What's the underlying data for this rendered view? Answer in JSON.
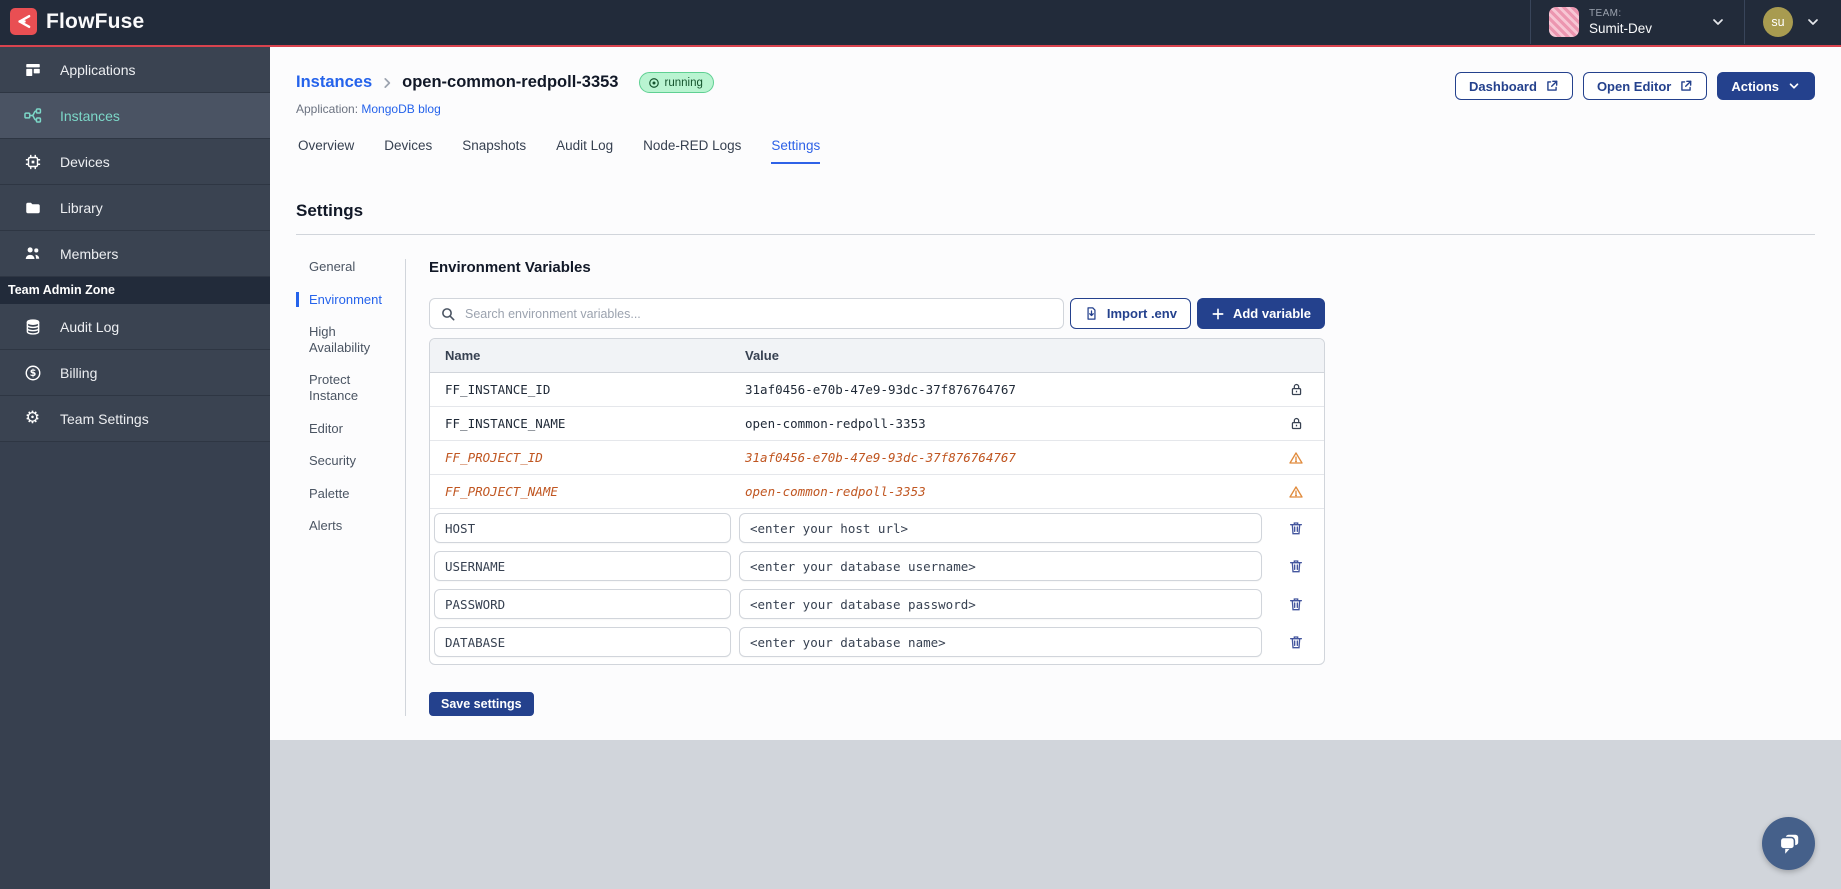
{
  "topbar": {
    "brand": "FlowFuse",
    "team_label": "TEAM:",
    "team_name": "Sumit-Dev",
    "user_initials": "su"
  },
  "sidebar": {
    "items": [
      {
        "label": "Applications",
        "icon": "applications-icon"
      },
      {
        "label": "Instances",
        "icon": "instances-icon",
        "active": true
      },
      {
        "label": "Devices",
        "icon": "devices-icon"
      },
      {
        "label": "Library",
        "icon": "library-icon"
      },
      {
        "label": "Members",
        "icon": "members-icon"
      }
    ],
    "admin_zone_label": "Team Admin Zone",
    "admin_items": [
      {
        "label": "Audit Log",
        "icon": "audit-log-icon"
      },
      {
        "label": "Billing",
        "icon": "billing-icon"
      },
      {
        "label": "Team Settings",
        "icon": "gear-icon"
      }
    ]
  },
  "header": {
    "breadcrumb_parent": "Instances",
    "instance_name": "open-common-redpoll-3353",
    "status": "running",
    "application_label": "Application:",
    "application_name": "MongoDB blog",
    "dashboard_label": "Dashboard",
    "open_editor_label": "Open Editor",
    "actions_label": "Actions"
  },
  "tabs": {
    "items": [
      "Overview",
      "Devices",
      "Snapshots",
      "Audit Log",
      "Node-RED Logs",
      "Settings"
    ],
    "active": "Settings"
  },
  "settings": {
    "title": "Settings",
    "nav": [
      "General",
      "Environment",
      "High Availability",
      "Protect Instance",
      "Editor",
      "Security",
      "Palette",
      "Alerts"
    ],
    "active": "Environment"
  },
  "env": {
    "title": "Environment Variables",
    "search_placeholder": "Search environment variables...",
    "import_label": "Import .env",
    "add_label": "Add variable",
    "columns": [
      "Name",
      "Value"
    ],
    "rows": [
      {
        "name": "FF_INSTANCE_ID",
        "value": "31af0456-e70b-47e9-93dc-37f876764767",
        "type": "locked"
      },
      {
        "name": "FF_INSTANCE_NAME",
        "value": "open-common-redpoll-3353",
        "type": "locked"
      },
      {
        "name": "FF_PROJECT_ID",
        "value": "31af0456-e70b-47e9-93dc-37f876764767",
        "type": "deprecated"
      },
      {
        "name": "FF_PROJECT_NAME",
        "value": "open-common-redpoll-3353",
        "type": "deprecated"
      },
      {
        "name": "HOST",
        "value": "<enter your host url>",
        "type": "editable"
      },
      {
        "name": "USERNAME",
        "value": "<enter your database username>",
        "type": "editable"
      },
      {
        "name": "PASSWORD",
        "value": "<enter your database password>",
        "type": "editable"
      },
      {
        "name": "DATABASE",
        "value": "<enter your database name>",
        "type": "editable"
      }
    ],
    "save_label": "Save settings"
  },
  "colors": {
    "brand_red": "#E94F53",
    "accent_line": "#D9434E",
    "navy_button": "#24418D",
    "link_blue": "#2563EB",
    "active_teal": "#7CD7C8",
    "running_bg": "#B9F4D1",
    "warning_text": "#C05621"
  }
}
